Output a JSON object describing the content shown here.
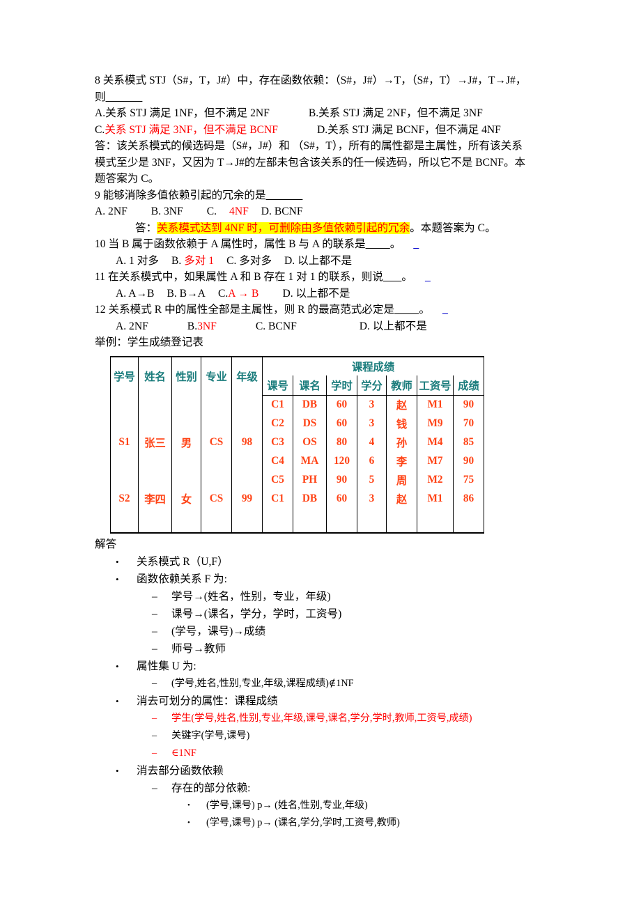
{
  "document": {
    "title": "数据库规范化习题与解答",
    "colors": {
      "answer_red": "#ff0000",
      "table_text_red": "#ff4417",
      "table_header_teal": "#1a7c7c",
      "highlight_yellow": "#ffff00",
      "link_blue": "#0000cc"
    }
  },
  "q8": {
    "stem_line1": "8 关系模式 STJ（S#，T，J#）中，存在函数依赖：（S#，J#）→T，（S#，T）→J#，T→J#，",
    "stem_line2_prefix": "则",
    "stem_line2_blank": "______",
    "option_a": "A.关系 STJ 满足 1NF，但不满足 2NF",
    "option_b": "B.关系 STJ 满足 2NF，但不满足 3NF",
    "option_c": "C.关系 STJ 满足 3NF，但不满足 BCNF",
    "option_c_prefix": "C.",
    "option_c_red": "关系 STJ 满足 3NF，但不满足 BCNF",
    "option_d": "D.关系 STJ 满足 BCNF，但不满足 4NF",
    "explain_line1": "答：该关系模式的候选码是（S#，J#）和 （S#，T），所有的属性都是主属性，所有该关系",
    "explain_line2": "模式至少是 3NF，又因为 T→J#的左部未包含该关系的任一候选码，所以它不是 BCNF。本",
    "explain_line3": "题答案为 C。"
  },
  "q9": {
    "stem": "9 能够消除多值依赖引起的冗余的是",
    "stem_blank": "______",
    "option_a": "A.   2NF",
    "option_b": "B.   3NF",
    "option_c_label": "C.",
    "option_c_value": "4NF",
    "option_d": "D.   BCNF",
    "answer_prefix": "答：",
    "answer_highlight": "关系模式达到 4NF 时，可删除由多值依赖引起的冗余",
    "answer_suffix": "。本题答案为 C。"
  },
  "q10": {
    "stem_prefix": "10 当 B 属于函数依赖于 A 属性时，属性 B 与 A 的联系是",
    "stem_blank": "____",
    "stem_suffix": "。",
    "mark": "_",
    "option_a": "A. 1 对多",
    "option_b_label": "B.",
    "option_b_value": "多对 1",
    "option_c": "C. 多对多",
    "option_d": "D. 以上都不是"
  },
  "q11": {
    "stem_prefix": "11 在关系模式中，如果属性 A 和 B 存在 1 对 1 的联系，则说",
    "stem_blank": "___",
    "stem_suffix": "。",
    "mark": "_",
    "option_a": "A. A→B",
    "option_b": "B. B→A",
    "option_c_label": "C.",
    "option_c_value": "A  →  B",
    "option_d": "D. 以上都不是"
  },
  "q12": {
    "stem_prefix": "12 关系模式 R 中的属性全部是主属性，则 R 的最高范式必定是",
    "stem_blank": "____",
    "stem_suffix": "。",
    "mark": "_",
    "option_a": "A. 2NF",
    "option_b_label": "B.",
    "option_b_value": "3NF",
    "option_c": "C. BCNF",
    "option_d": "D. 以上都不是"
  },
  "example": {
    "caption": "举例：学生成绩登记表"
  },
  "table": {
    "group_header": "课程成绩",
    "left_headers": [
      "学号",
      "姓名",
      "性别",
      "专业",
      "年级"
    ],
    "right_headers": [
      "课号",
      "课名",
      "学时",
      "学分",
      "教师",
      "工资号",
      "成绩"
    ],
    "rows": [
      {
        "student": [
          "S1",
          "张三",
          "男",
          "CS",
          "98"
        ],
        "courses": [
          [
            "C1",
            "DB",
            "60",
            "3",
            "赵",
            "M1",
            "90"
          ],
          [
            "C2",
            "DS",
            "60",
            "3",
            "钱",
            "M9",
            "70"
          ],
          [
            "C3",
            "OS",
            "80",
            "4",
            "孙",
            "M4",
            "85"
          ],
          [
            "C4",
            "MA",
            "120",
            "6",
            "李",
            "M7",
            "90"
          ],
          [
            "C5",
            "PH",
            "90",
            "5",
            "周",
            "M2",
            "75"
          ]
        ]
      },
      {
        "student": [
          "S2",
          "李四",
          "女",
          "CS",
          "99"
        ],
        "courses": [
          [
            "C1",
            "DB",
            "60",
            "3",
            "赵",
            "M1",
            "86"
          ]
        ]
      }
    ]
  },
  "solution": {
    "heading": "解答",
    "items": [
      {
        "level": 1,
        "text": "关系模式 R（U,F）"
      },
      {
        "level": 1,
        "text": "函数依赖关系 F 为:"
      },
      {
        "level": 2,
        "text": "学号→(姓名，性别，专业，年级)"
      },
      {
        "level": 2,
        "text": "课号→(课名，学分，学时，工资号)"
      },
      {
        "level": 2,
        "text": "(学号，课号)→成绩"
      },
      {
        "level": 2,
        "text": "师号→教师"
      },
      {
        "level": 1,
        "text": "属性集 U 为:"
      },
      {
        "level": 2,
        "text": "(学号,姓名,性别,专业,年级,课程成绩)∉1NF"
      },
      {
        "level": 1,
        "text": "消去可划分的属性：课程成绩"
      },
      {
        "level": 2,
        "text": "学生(学号,姓名,性别,专业,年级,课号,课名,学分,学时,教师,工资号,成绩)",
        "red": true
      },
      {
        "level": 2,
        "text": "关键字(学号,课号)"
      },
      {
        "level": 2,
        "text": "∈1NF",
        "red": true
      },
      {
        "level": 1,
        "text": "消去部分函数依赖"
      },
      {
        "level": 2,
        "text": "存在的部分依赖:"
      },
      {
        "level": 3,
        "text": "(学号,课号) p→  (姓名,性别,专业,年级)"
      },
      {
        "level": 3,
        "text": "(学号,课号) p→  (课名,学分,学时,工资号,教师)"
      }
    ]
  }
}
